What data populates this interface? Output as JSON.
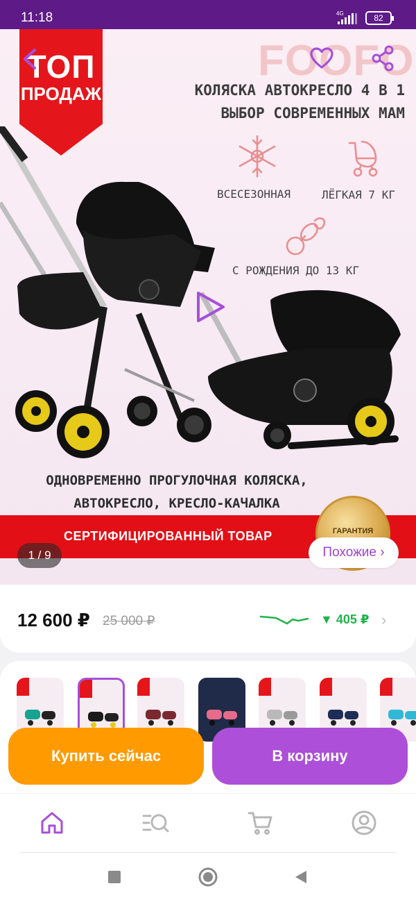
{
  "status_bar": {
    "time": "11:18",
    "network": "4G",
    "battery": "82"
  },
  "hero": {
    "badge_line1": "ТОП",
    "badge_line2": "ПРОДАЖ",
    "brand": "FOOFOO",
    "headline_line1": "КОЛЯСКА АВТОКРЕСЛО 4 В 1",
    "headline_line2": "ВЫБОР СОВРЕМЕННЫХ МАМ",
    "feature_1": "ВСЕСЕЗОННАЯ",
    "feature_2": "ЛЁГКАЯ 7 КГ",
    "feature_3": "С РОЖДЕНИЯ ДО 13 КГ",
    "caption_line1": "ОДНОВРЕМЕННО ПРОГУЛОЧНАЯ КОЛЯСКА,",
    "caption_line2": "АВТОКРЕСЛО, КРЕСЛО-КАЧАЛКА",
    "certified": "СЕРТИФИЦИРОВАННЫЙ ТОВАР",
    "seal": "ГАРАНТИЯ",
    "counter": "1 / 9",
    "similar_button": "Похожие ›"
  },
  "price": {
    "current": "12 600 ₽",
    "old": "25 000 ₽",
    "drop": "▼ 405 ₽"
  },
  "thumbnails": {
    "count": 7,
    "selected_index": 1
  },
  "actions": {
    "buy_now": "Купить сейчас",
    "add_to_cart": "В корзину"
  },
  "bottom_nav": [
    "home-icon",
    "catalog-search-icon",
    "cart-icon",
    "profile-icon"
  ],
  "colors": {
    "status_bar": "#5e1a87",
    "accent_purple": "#ad4fd8",
    "buy_orange": "#ff9a00",
    "sale_red": "#e20f16",
    "price_drop_green": "#21b24b"
  }
}
